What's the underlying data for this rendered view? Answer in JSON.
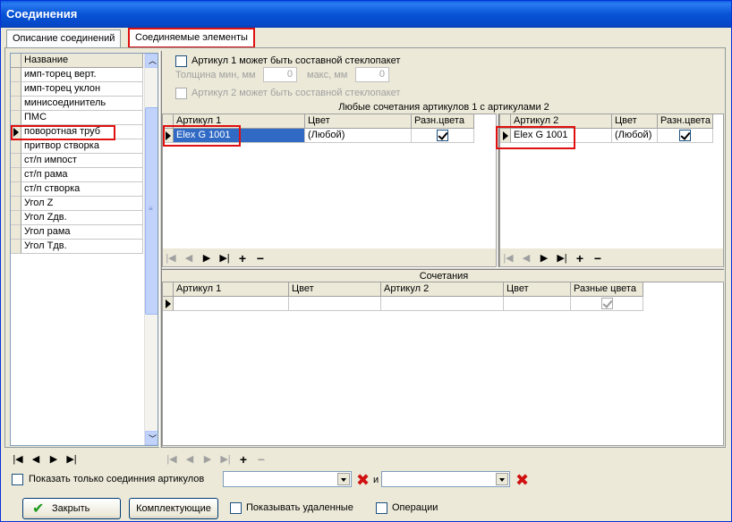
{
  "window": {
    "title": "Соединения"
  },
  "tabs": [
    {
      "label": "Описание соединений"
    },
    {
      "label": "Соединяемые элементы"
    }
  ],
  "left_list": {
    "header": "Название",
    "items": [
      "имп-торец верт.",
      "имп-торец уклон",
      "минисоединитель",
      "ПМС",
      "поворотная труб",
      "притвор створка",
      "ст/п импост",
      "ст/п рама",
      "ст/п створка",
      "Угол Z",
      "Угол Zдв.",
      "Угол рама",
      "Угол Тдв."
    ],
    "selected_index": 4
  },
  "options": {
    "art1_composite": "Артикул 1 может быть составной стеклопакет",
    "thickness_min_label": "Толщина мин, мм",
    "thickness_min_value": "0",
    "thickness_max_label": "макс, мм",
    "thickness_max_value": "0",
    "art2_composite": "Артикул 2 может быть составной стеклопакет"
  },
  "combos_section": {
    "title": "Любые сочетания артикулов 1 с артикулами 2"
  },
  "grid1": {
    "headers": [
      "Артикул 1",
      "Цвет",
      "Разн.цвета"
    ],
    "row": {
      "article": "Elex G 1001",
      "color": "(Любой)",
      "diff_colors": true
    }
  },
  "grid2": {
    "headers": [
      "Артикул 2",
      "Цвет",
      "Разн.цвета"
    ],
    "row": {
      "article": "Elex G 1001",
      "color": "(Любой)",
      "diff_colors": true
    }
  },
  "combinations": {
    "title": "Сочетания",
    "headers": [
      "Артикул 1",
      "Цвет",
      "Артикул 2",
      "Цвет",
      "Разные цвета"
    ]
  },
  "nav_glyphs": {
    "first": "|◀",
    "prev": "◀",
    "next": "▶",
    "last": "▶|",
    "add": "+",
    "remove": "−"
  },
  "bottom": {
    "show_only_label": "Показать только соединния артикулов",
    "and_label": "и",
    "close_button": "Закрыть",
    "components_button": "Комплектующие",
    "show_deleted": "Показывать удаленные",
    "operations": "Операции"
  },
  "colors": {
    "title_bar": "#0853d6",
    "selection": "#316ac5",
    "highlight_box": "#e01010",
    "delete_x": "#d01010"
  }
}
